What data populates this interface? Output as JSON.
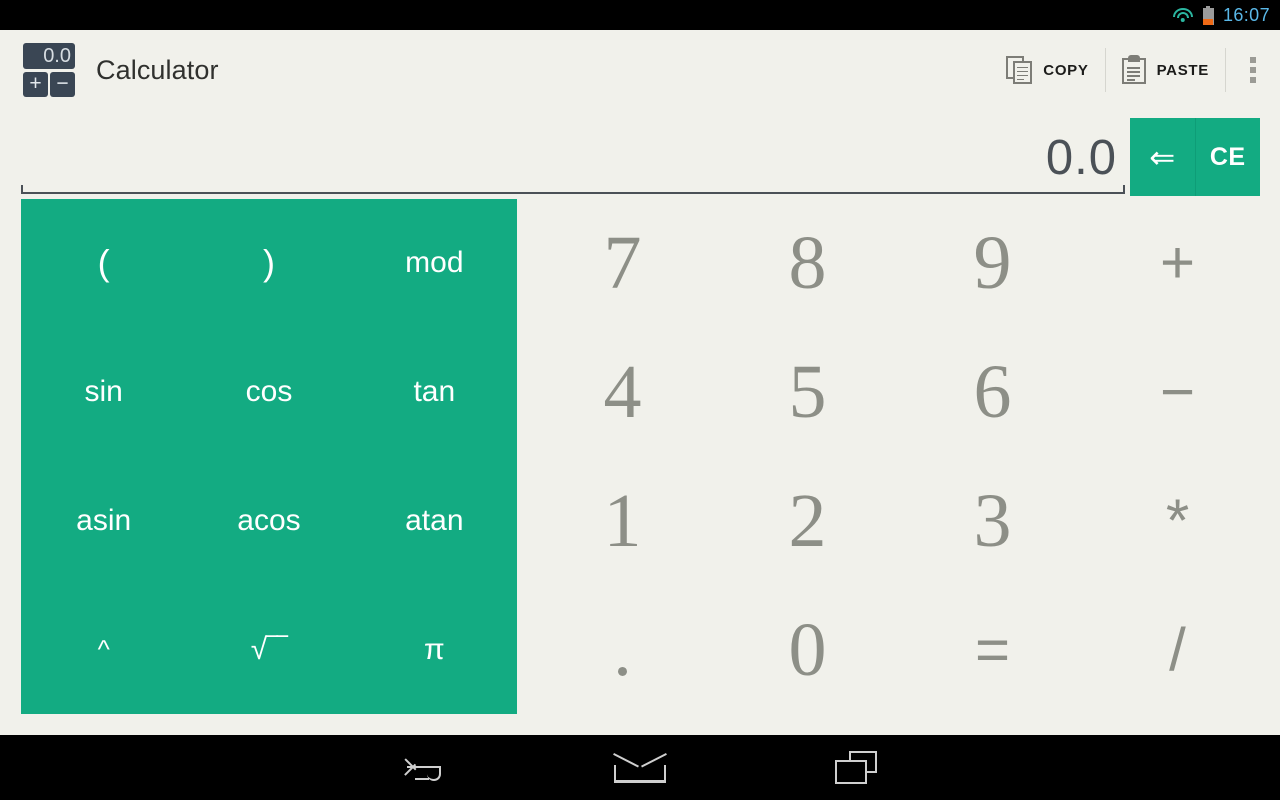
{
  "status_bar": {
    "clock": "16:07",
    "wifi_icon": "wifi-icon",
    "battery_icon": "battery-icon",
    "clock_color": "#5ab8e8",
    "wifi_color": "#2bb6a0",
    "battery_low_color": "#f06a16"
  },
  "action_bar": {
    "app_icon": {
      "name": "calculator-app-icon",
      "display_text": "0.0",
      "plus_key": "+",
      "minus_key": "−",
      "color": "#3a4654"
    },
    "title": "Calculator",
    "copy_label": "COPY",
    "paste_label": "PASTE",
    "copy_icon": "copy-icon",
    "paste_icon": "paste-icon",
    "overflow_icon": "overflow-menu-icon"
  },
  "display": {
    "value": "0.0",
    "backspace_glyph": "⇐",
    "clear_entry_label": "CE",
    "accent_color": "#13ab82"
  },
  "function_pad": {
    "background_color": "#13ab82",
    "text_color": "#ffffff",
    "keys": [
      {
        "label": "(",
        "name": "open-paren-key",
        "class": "paren"
      },
      {
        "label": ")",
        "name": "close-paren-key",
        "class": "paren"
      },
      {
        "label": "mod",
        "name": "mod-key",
        "class": ""
      },
      {
        "label": "sin",
        "name": "sin-key",
        "class": ""
      },
      {
        "label": "cos",
        "name": "cos-key",
        "class": ""
      },
      {
        "label": "tan",
        "name": "tan-key",
        "class": ""
      },
      {
        "label": "asin",
        "name": "asin-key",
        "class": ""
      },
      {
        "label": "acos",
        "name": "acos-key",
        "class": ""
      },
      {
        "label": "atan",
        "name": "atan-key",
        "class": ""
      },
      {
        "label": "^",
        "name": "power-key",
        "class": "caret"
      },
      {
        "label": "√‾‾",
        "name": "sqrt-key",
        "class": "sqrt"
      },
      {
        "label": "π",
        "name": "pi-key",
        "class": "pi"
      }
    ]
  },
  "num_pad": {
    "text_color": "#8d8f87",
    "keys": [
      {
        "label": "7",
        "name": "digit-7-key",
        "class": ""
      },
      {
        "label": "8",
        "name": "digit-8-key",
        "class": ""
      },
      {
        "label": "9",
        "name": "digit-9-key",
        "class": ""
      },
      {
        "label": "+",
        "name": "plus-key",
        "class": "op"
      },
      {
        "label": "4",
        "name": "digit-4-key",
        "class": ""
      },
      {
        "label": "5",
        "name": "digit-5-key",
        "class": ""
      },
      {
        "label": "6",
        "name": "digit-6-key",
        "class": ""
      },
      {
        "label": "−",
        "name": "minus-key",
        "class": "op"
      },
      {
        "label": "1",
        "name": "digit-1-key",
        "class": ""
      },
      {
        "label": "2",
        "name": "digit-2-key",
        "class": ""
      },
      {
        "label": "3",
        "name": "digit-3-key",
        "class": ""
      },
      {
        "label": "*",
        "name": "multiply-key",
        "class": "op"
      },
      {
        "label": ".",
        "name": "decimal-point-key",
        "class": "dot"
      },
      {
        "label": "0",
        "name": "digit-0-key",
        "class": ""
      },
      {
        "label": "=",
        "name": "equals-key",
        "class": "op"
      },
      {
        "label": "/",
        "name": "divide-key",
        "class": "op"
      }
    ]
  },
  "nav_bar": {
    "back_icon": "back-icon",
    "home_icon": "home-icon",
    "recents_icon": "recents-icon"
  }
}
